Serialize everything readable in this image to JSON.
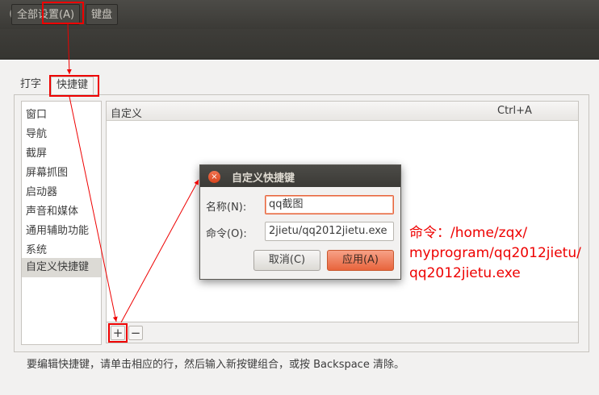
{
  "window": {
    "title": "键盘",
    "close_glyph": "×",
    "min_glyph": "−"
  },
  "toolbar": {
    "all_settings": "全部设置(A)",
    "current": "键盘"
  },
  "tabs": [
    "打字",
    "快捷键"
  ],
  "categories": [
    "窗口",
    "导航",
    "截屏",
    "屏幕抓图",
    "启动器",
    "声音和媒体",
    "通用辅助功能",
    "系统",
    "自定义快捷键"
  ],
  "table": {
    "col_name": "自定义",
    "col_accel": "Ctrl+A"
  },
  "buttons": {
    "add": "+",
    "remove": "−"
  },
  "hint": "要编辑快捷键，请单击相应的行，然后输入新按键组合，或按 Backspace 清除。",
  "dialog": {
    "title": "自定义快捷键",
    "name_label": "名称(N):",
    "name_value": "qq截图",
    "command_label": "命令(O):",
    "command_value": "2jietu/qq2012jietu.exe",
    "cancel": "取消(C)",
    "apply": "应用(A)"
  },
  "annotation": {
    "line1": "命令：/home/zqx/",
    "line2": "myprogram/qq2012jietu/",
    "line3": "qq2012jietu.exe",
    "color": "#ee0000"
  }
}
